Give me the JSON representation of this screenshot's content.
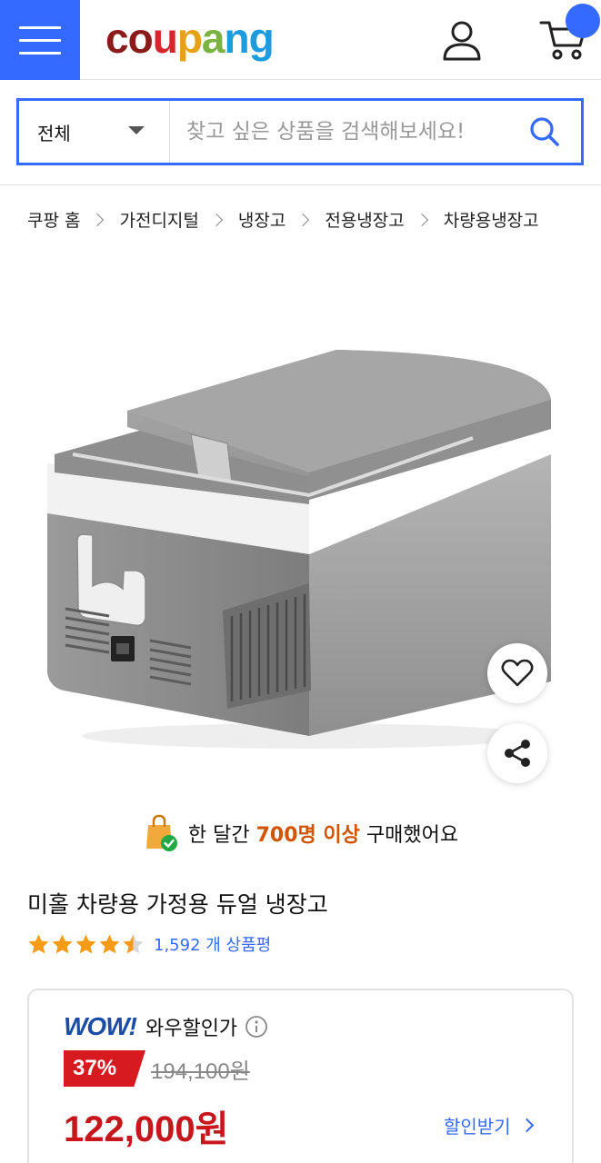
{
  "header": {
    "menu_icon": "hamburger-icon",
    "logo_text": [
      "c",
      "o",
      "u",
      "p",
      "a",
      "n",
      "g"
    ],
    "logo_colors": [
      "#8b1a1a",
      "#8b1a1a",
      "#d9232d",
      "#e6a115",
      "#7bb342",
      "#1b9be0",
      "#1b9be0"
    ],
    "user_icon": "user-icon",
    "cart_icon": "cart-icon",
    "accent": "#346aff"
  },
  "search": {
    "category": "전체",
    "placeholder": "찾고 싶은 상품을 검색해보세요!",
    "button_icon": "search-icon"
  },
  "breadcrumb": [
    "쿠팡 홈",
    "가전디지털",
    "냉장고",
    "전용냉장고",
    "차량용냉장고"
  ],
  "actions": {
    "wishlist_icon": "heart-icon",
    "share_icon": "share-icon"
  },
  "purchase_notice": {
    "prefix": "한 달간",
    "highlight": "700명 이상",
    "suffix": "구매했어요"
  },
  "product": {
    "title": "미홀 차량용 가정용 듀얼 냉장고",
    "rating": 4.5,
    "review_count_text": "1,592 개 상품평"
  },
  "price": {
    "wow_logo": "WOW!",
    "wow_label": "와우할인가",
    "discount_rate": "37%",
    "original_price": "194,100원",
    "sale_price": "122,000원",
    "coupon_link": "할인받기"
  }
}
